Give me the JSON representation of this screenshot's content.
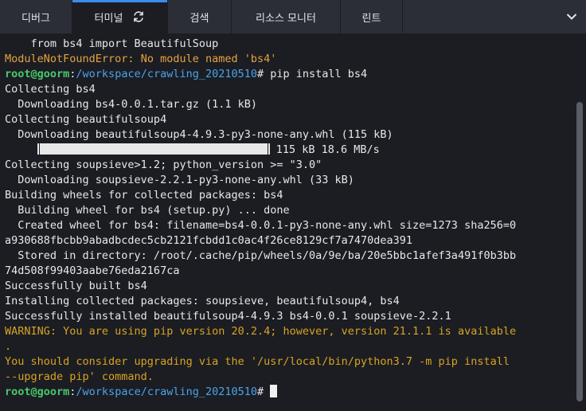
{
  "tabs": [
    {
      "label": "디버그",
      "active": false
    },
    {
      "label": "터미널",
      "active": true
    },
    {
      "label": "검색",
      "active": false
    },
    {
      "label": "리소스 모니터",
      "active": false
    },
    {
      "label": "린트",
      "active": false
    }
  ],
  "terminal": {
    "line01": "    from bs4 import BeautifulSoup",
    "line02_err": "ModuleNotFoundError:",
    "line02_rest": " No module named 'bs4'",
    "prompt_user": "root@goorm",
    "prompt_colon": ":",
    "prompt_path": "/workspace/crawling_20210510",
    "prompt_cmd": "# pip install bs4",
    "line04": "Collecting bs4",
    "line05": "  Downloading bs4-0.0.1.tar.gz (1.1 kB)",
    "line06": "Collecting beautifulsoup4",
    "line07": "  Downloading beautifulsoup4-4.9.3-py3-none-any.whl (115 kB)",
    "line08_prefix": "     ",
    "line08_suffix": " 115 kB 18.6 MB/s",
    "progress": 1.0,
    "line09": "Collecting soupsieve>1.2; python_version >= \"3.0\"",
    "line10": "  Downloading soupsieve-2.2.1-py3-none-any.whl (33 kB)",
    "line11": "Building wheels for collected packages: bs4",
    "line12": "  Building wheel for bs4 (setup.py) ... done",
    "line13": "  Created wheel for bs4: filename=bs4-0.0.1-py3-none-any.whl size=1273 sha256=0",
    "line14": "a930688fbcbb9abadbcdec5cb2121fcbdd1c0ac4f26ce8129cf7a7470dea391",
    "line15": "  Stored in directory: /root/.cache/pip/wheels/0a/9e/ba/20e5bbc1afef3a491f0b3bb",
    "line16": "74d508f99403aabe76eda2167ca",
    "line17": "Successfully built bs4",
    "line18": "Installing collected packages: soupsieve, beautifulsoup4, bs4",
    "line19": "Successfully installed beautifulsoup4-4.9.3 bs4-0.0.1 soupsieve-2.2.1",
    "line20": "WARNING: You are using pip version 20.2.4; however, version 21.1.1 is available",
    "line21": ".",
    "line22": "You should consider upgrading via the '/usr/local/bin/python3.7 -m pip install",
    "line23": "--upgrade pip' command.",
    "prompt2_user": "root@goorm",
    "prompt2_colon": ":",
    "prompt2_path": "/workspace/crawling_20210510",
    "prompt2_hash": "# "
  },
  "colors": {
    "background": "#1b1d23",
    "tabbar": "#2b2e36",
    "active_indicator": "#3c8cf0",
    "prompt_user": "#49c96a",
    "prompt_path": "#4aa3e8",
    "warning": "#d8a31f",
    "error": "#e5a33f"
  },
  "icons": {
    "sync": "sync-icon",
    "collapse": "chevron-down-icon"
  }
}
